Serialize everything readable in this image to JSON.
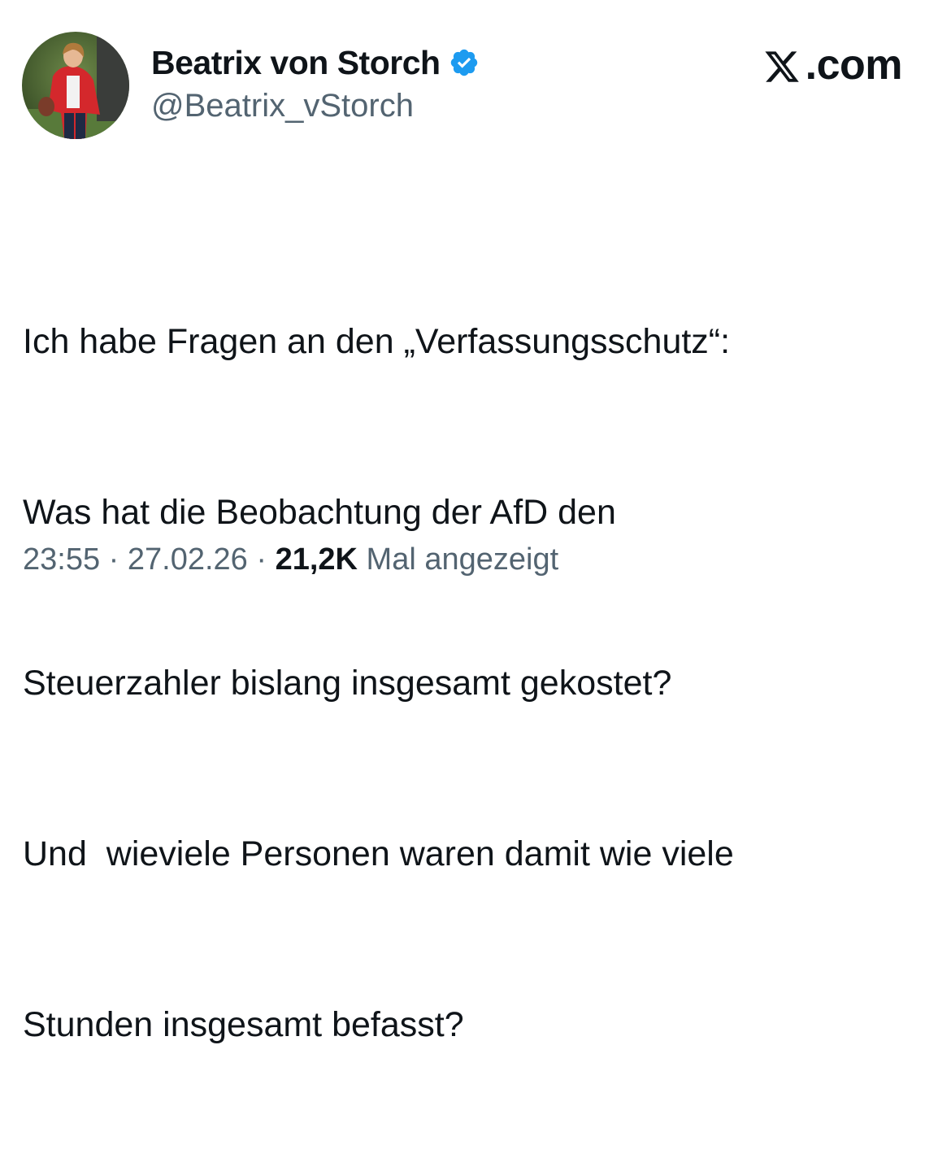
{
  "author": {
    "display_name": "Beatrix von Storch",
    "handle": "@Beatrix_vStorch",
    "verified": true,
    "verified_color": "#1d9bf0"
  },
  "brand": {
    "label": ".com"
  },
  "tweet": {
    "lines": [
      "Ich habe Fragen an den „Verfassungsschutz“:",
      "Was hat die Beobachtung der AfD den",
      "Steuerzahler bislang insgesamt gekostet?",
      "Und  wieviele Personen waren damit wie viele",
      "Stunden insgesamt befasst?"
    ]
  },
  "meta": {
    "time": "23:55",
    "separator": " · ",
    "date": "27.02.26",
    "views_count": "21,2K",
    "views_label": "Mal angezeigt"
  },
  "colors": {
    "text_primary": "#0f1419",
    "text_secondary": "#536471",
    "background": "#ffffff"
  },
  "icons": {
    "verified": "verified-badge-icon",
    "brand": "x-logo-icon"
  }
}
